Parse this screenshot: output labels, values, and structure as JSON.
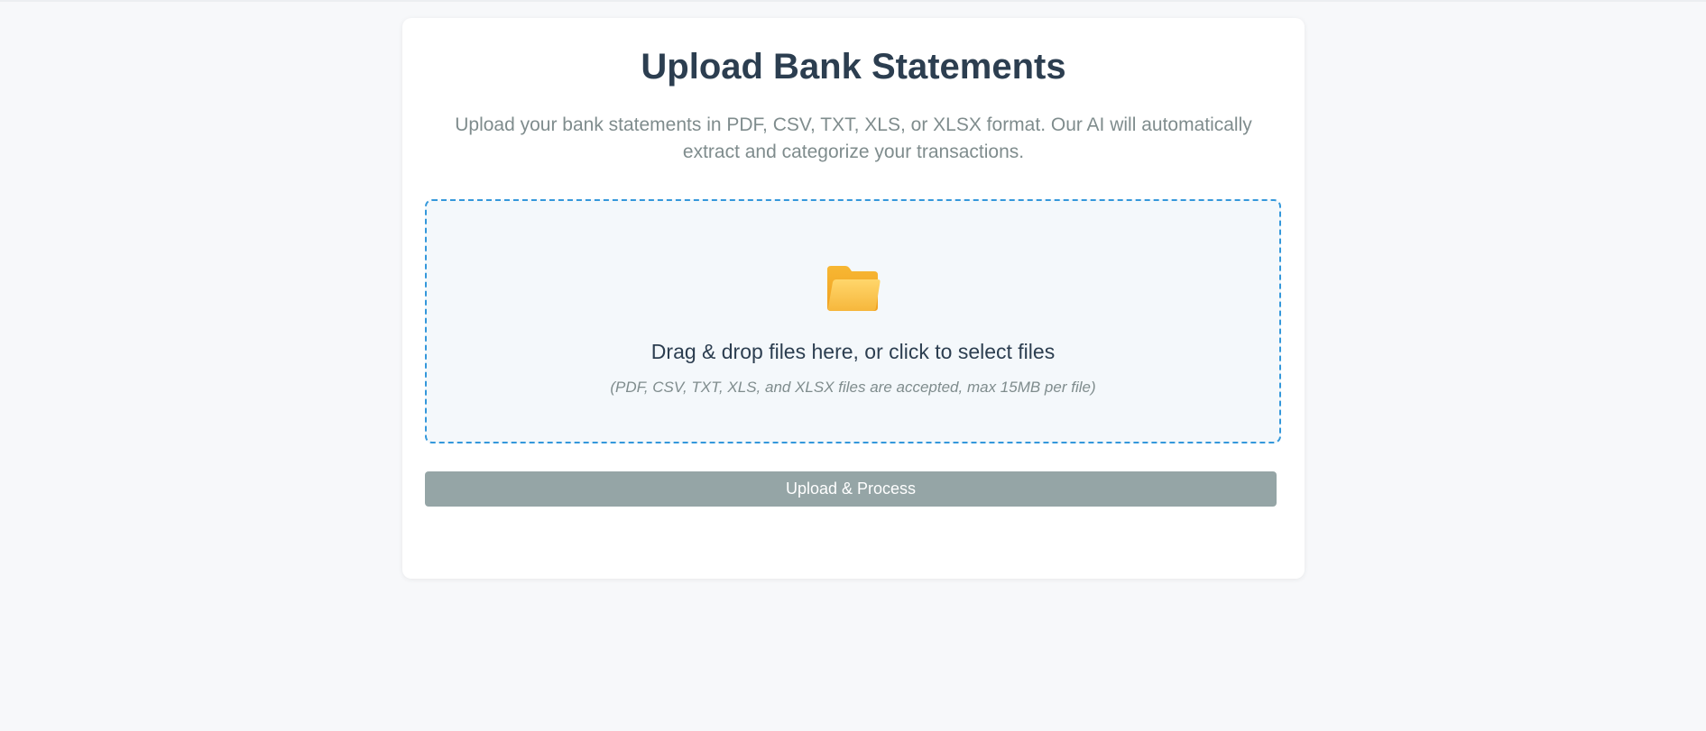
{
  "page": {
    "title": "Upload Bank Statements",
    "subtitle": "Upload your bank statements in PDF, CSV, TXT, XLS, or XLSX format. Our AI will automatically extract and categorize your transactions."
  },
  "dropzone": {
    "icon": "folder-icon",
    "prompt": "Drag & drop files here, or click to select files",
    "hint": "(PDF, CSV, TXT, XLS, and XLSX files are accepted, max 15MB per file)"
  },
  "actions": {
    "upload_label": "Upload & Process",
    "upload_disabled": true
  },
  "colors": {
    "title": "#2c3e50",
    "muted": "#7f8c8d",
    "dropzone_border": "#3498db",
    "dropzone_bg": "#f4f8fb",
    "button_disabled": "#95a5a6",
    "page_bg": "#f7f8fa",
    "folder": "#f9c13c"
  }
}
